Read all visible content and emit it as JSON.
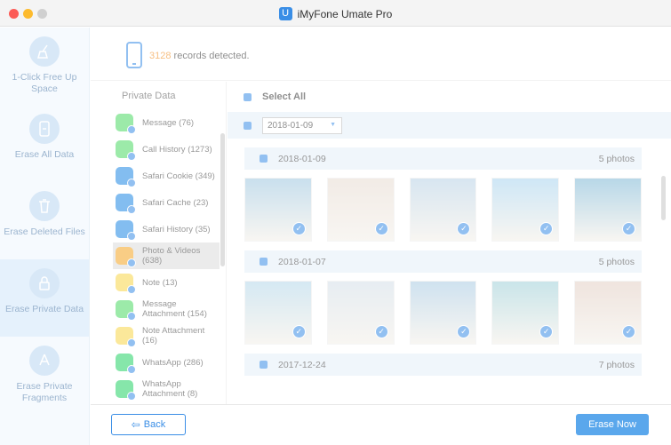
{
  "window": {
    "title": "iMyFone Umate Pro",
    "logo_letter": "U"
  },
  "sidebar": {
    "items": [
      {
        "label": "1-Click Free Up Space",
        "icon": "broom-icon"
      },
      {
        "label": "Erase All Data",
        "icon": "phone-erase-icon"
      },
      {
        "label": "Erase Deleted Files",
        "icon": "trash-icon"
      },
      {
        "label": "Erase Private Data",
        "icon": "lock-icon",
        "active": true
      },
      {
        "label": "Erase Private Fragments",
        "icon": "app-store-icon"
      }
    ]
  },
  "records": {
    "count": "3128",
    "text": " records detected."
  },
  "categories": {
    "heading": "Private Data",
    "items": [
      {
        "label": "Message (76)",
        "color": "#4cd964"
      },
      {
        "label": "Call History (1273)",
        "color": "#4cd964"
      },
      {
        "label": "Safari Cookie (349)",
        "color": "#1e88e5"
      },
      {
        "label": "Safari Cache (23)",
        "color": "#1e88e5"
      },
      {
        "label": "Safari History (35)",
        "color": "#1e88e5"
      },
      {
        "label": "Photo & Videos (638)",
        "color": "#f5a623",
        "active": true
      },
      {
        "label": "Note (13)",
        "color": "#f8d649"
      },
      {
        "label": "Message Attachment (154)",
        "color": "#4cd964"
      },
      {
        "label": "Note Attachment (16)",
        "color": "#f8d649"
      },
      {
        "label": "WhatsApp (286)",
        "color": "#25d366"
      },
      {
        "label": "WhatsApp Attachment (8)",
        "color": "#25d366"
      }
    ]
  },
  "photos": {
    "select_all": "Select All",
    "date_filter": "2018-01-09",
    "groups": [
      {
        "date": "2018-01-09",
        "count": "5 photos",
        "thumbs": [
          "#9ec7e0",
          "#e8dcd2",
          "#b8d2e6",
          "#a8d4ef",
          "#7eb8d6"
        ]
      },
      {
        "date": "2018-01-07",
        "count": "5 photos",
        "thumbs": [
          "#b4d7ea",
          "#d4dfe8",
          "#a9cbe3",
          "#9fd0d8",
          "#e3cfc4"
        ]
      },
      {
        "date": "2017-12-24",
        "count": "7 photos",
        "thumbs": []
      }
    ]
  },
  "buttons": {
    "back": "Back",
    "erase": "Erase Now"
  },
  "colors": {
    "accent": "#3a8ee6",
    "count": "#f08a1c"
  }
}
